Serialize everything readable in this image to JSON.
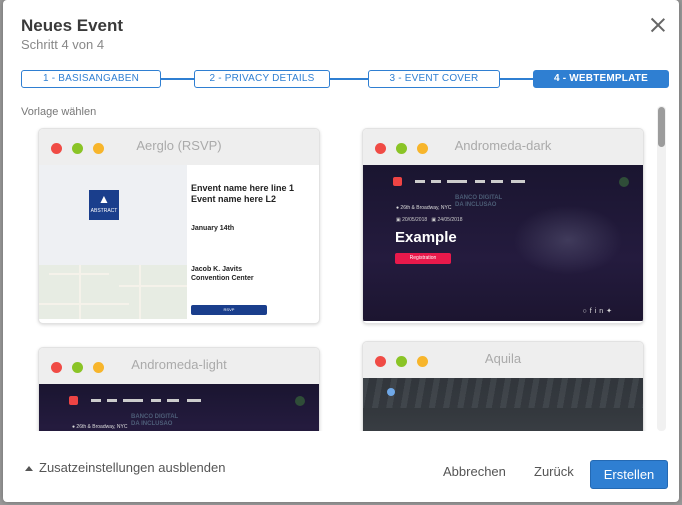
{
  "dialog": {
    "title": "Neues Event",
    "subtitle": "Schritt 4 von 4"
  },
  "steps": [
    {
      "label": "1 - BASISANGABEN"
    },
    {
      "label": "2 - PRIVACY DETAILS"
    },
    {
      "label": "3 - EVENT COVER"
    },
    {
      "label": "4 - WEBTEMPLATE",
      "active": true
    }
  ],
  "section_label": "Vorlage wählen",
  "templates": [
    {
      "name": "Aerglo (RSVP)",
      "event_title": "Envent name here line 1\nEvent name here L2",
      "date": "January 14th",
      "venue": "Jacob K. Javits\nConvention Center",
      "logo_text": "ABSTRACT",
      "button": "RSVP"
    },
    {
      "name": "Andromeda-dark",
      "location": "26th & Broadway, NYC",
      "start_date": "20/05/2018",
      "end_date": "24/05/2018",
      "headline": "Example",
      "button": "Registration",
      "bg_text": "BANCO DIGITAL\nDA INCLUSAO"
    },
    {
      "name": "Andromeda-light",
      "location": "26th & Broadway, NYC",
      "bg_text": "BANCO DIGITAL\nDA INCLUSAO"
    },
    {
      "name": "Aquila"
    }
  ],
  "footer": {
    "toggle_label": "Zusatzeinstellungen ausblenden",
    "cancel": "Abbrechen",
    "back": "Zurück",
    "create": "Erstellen"
  },
  "colors": {
    "primary": "#2f7fd2",
    "registration": "#e8194b"
  }
}
